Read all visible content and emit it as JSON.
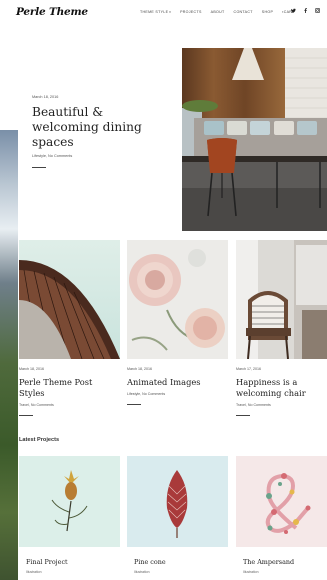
{
  "site": {
    "logo": "Perle Theme"
  },
  "nav": {
    "items": [
      {
        "label": "THEME STYLE"
      },
      {
        "label": "PROJECTS"
      },
      {
        "label": "ABOUT"
      },
      {
        "label": "CONTACT"
      },
      {
        "label": "SHOP"
      },
      {
        "label": "CART"
      }
    ],
    "caret": "▾",
    "cart_icon": "cart-icon",
    "social_icons": [
      "twitter-icon",
      "facebook-icon",
      "instagram-icon"
    ]
  },
  "hero": {
    "date": "March 18, 2016",
    "title": "Beautiful & welcoming dining spaces",
    "meta": "Lifestyle, No Comments"
  },
  "posts": [
    {
      "date": "March 18, 2016",
      "title": "Perle Theme Post Styles",
      "meta": "Travel, No Comments"
    },
    {
      "date": "March 18, 2016",
      "title": "Animated Images",
      "meta": "Lifestyle, No Comments"
    },
    {
      "date": "March 17, 2016",
      "title": "Happiness is a welcoming chair",
      "meta": "Travel, No Comments"
    }
  ],
  "projects": {
    "heading": "Latest Projects",
    "items": [
      {
        "title": "Final Project",
        "category": "Illustration"
      },
      {
        "title": "Pine cone",
        "category": "Illustration"
      },
      {
        "title": "The Ampersand",
        "category": "Illustration"
      }
    ]
  }
}
